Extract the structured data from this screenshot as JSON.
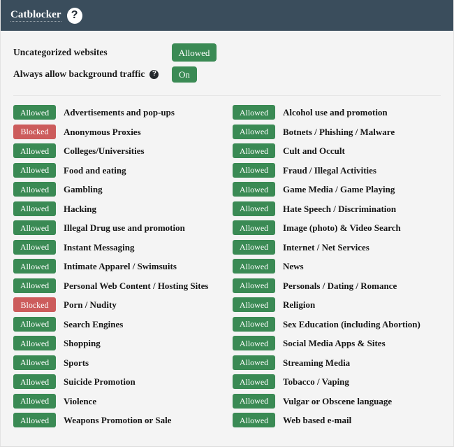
{
  "header": {
    "title": "Catblocker",
    "help_icon": "help-circle-icon",
    "help_glyph": "?",
    "background_color": "#3a4d5c"
  },
  "colors": {
    "allowed": "#3a8a54",
    "blocked": "#cc5c5c",
    "page_background": "#f4f4f4",
    "divider": "#e6e6e6"
  },
  "settings": {
    "uncategorized": {
      "label": "Uncategorized websites",
      "state": "Allowed"
    },
    "background_traffic": {
      "label": "Always allow background traffic",
      "help_icon": "help-circle-icon",
      "help_glyph": "?",
      "state": "On"
    }
  },
  "categories": {
    "left": [
      {
        "state": "Allowed",
        "label": "Advertisements and pop-ups"
      },
      {
        "state": "Blocked",
        "label": "Anonymous Proxies"
      },
      {
        "state": "Allowed",
        "label": "Colleges/Universities"
      },
      {
        "state": "Allowed",
        "label": "Food and eating"
      },
      {
        "state": "Allowed",
        "label": "Gambling"
      },
      {
        "state": "Allowed",
        "label": "Hacking"
      },
      {
        "state": "Allowed",
        "label": "Illegal Drug use and promotion"
      },
      {
        "state": "Allowed",
        "label": "Instant Messaging"
      },
      {
        "state": "Allowed",
        "label": "Intimate Apparel / Swimsuits"
      },
      {
        "state": "Allowed",
        "label": "Personal Web Content / Hosting Sites"
      },
      {
        "state": "Blocked",
        "label": "Porn / Nudity"
      },
      {
        "state": "Allowed",
        "label": "Search Engines"
      },
      {
        "state": "Allowed",
        "label": "Shopping"
      },
      {
        "state": "Allowed",
        "label": "Sports"
      },
      {
        "state": "Allowed",
        "label": "Suicide Promotion"
      },
      {
        "state": "Allowed",
        "label": "Violence"
      },
      {
        "state": "Allowed",
        "label": "Weapons Promotion or Sale"
      }
    ],
    "right": [
      {
        "state": "Allowed",
        "label": "Alcohol use and promotion"
      },
      {
        "state": "Allowed",
        "label": "Botnets / Phishing / Malware"
      },
      {
        "state": "Allowed",
        "label": "Cult and Occult"
      },
      {
        "state": "Allowed",
        "label": "Fraud / Illegal Activities"
      },
      {
        "state": "Allowed",
        "label": "Game Media / Game Playing"
      },
      {
        "state": "Allowed",
        "label": "Hate Speech / Discrimination"
      },
      {
        "state": "Allowed",
        "label": "Image (photo) & Video Search"
      },
      {
        "state": "Allowed",
        "label": "Internet / Net Services"
      },
      {
        "state": "Allowed",
        "label": "News"
      },
      {
        "state": "Allowed",
        "label": "Personals / Dating / Romance"
      },
      {
        "state": "Allowed",
        "label": "Religion"
      },
      {
        "state": "Allowed",
        "label": "Sex Education (including Abortion)"
      },
      {
        "state": "Allowed",
        "label": "Social Media Apps & Sites"
      },
      {
        "state": "Allowed",
        "label": "Streaming Media"
      },
      {
        "state": "Allowed",
        "label": "Tobacco / Vaping"
      },
      {
        "state": "Allowed",
        "label": "Vulgar or Obscene language"
      },
      {
        "state": "Allowed",
        "label": "Web based e-mail"
      }
    ]
  }
}
